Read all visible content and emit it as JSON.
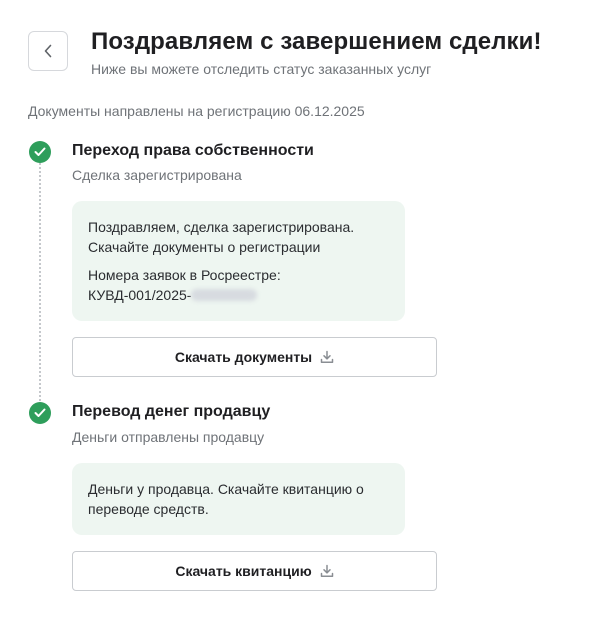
{
  "header": {
    "title": "Поздравляем с завершением сделки!",
    "subtitle": "Ниже вы можете отследить статус заказанных услуг"
  },
  "registration_note": "Документы направлены на регистрацию 06.12.2025",
  "colors": {
    "success": "#2e9e5b",
    "info_bg": "#eef6f1"
  },
  "steps": [
    {
      "title": "Переход права собственности",
      "status": "Сделка зарегистрирована",
      "icon": "check-icon",
      "info_line1": "Поздравляем, сделка зарегистрирована.",
      "info_line2": "Скачайте документы о регистрации",
      "requests_label": "Номера заявок в Росреестре:",
      "request_number_prefix": "КУВД-001/2025-",
      "button_label": "Скачать документы",
      "button_icon": "download-icon"
    },
    {
      "title": "Перевод денег продавцу",
      "status": "Деньги отправлены продавцу",
      "icon": "check-icon",
      "info_line1": "Деньги у продавца. Скачайте квитанцию о",
      "info_line2": "переводе средств.",
      "button_label": "Скачать квитанцию",
      "button_icon": "download-icon"
    }
  ]
}
